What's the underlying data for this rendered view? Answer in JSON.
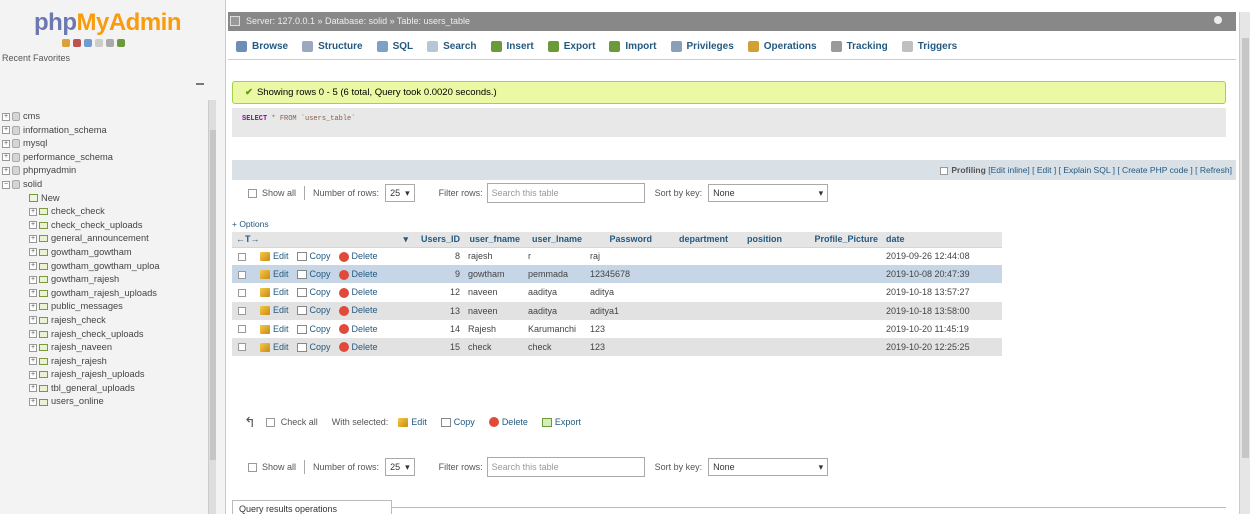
{
  "logo": {
    "part1": "php",
    "part2": "MyAdmin"
  },
  "recent_label": "Recent  Favorites",
  "tree": [
    {
      "label": "cms",
      "level": 0,
      "kind": "db"
    },
    {
      "label": "information_schema",
      "level": 0,
      "kind": "db"
    },
    {
      "label": "mysql",
      "level": 0,
      "kind": "db"
    },
    {
      "label": "performance_schema",
      "level": 0,
      "kind": "db"
    },
    {
      "label": "phpmyadmin",
      "level": 0,
      "kind": "db"
    },
    {
      "label": "solid",
      "level": 0,
      "kind": "db",
      "open": true
    },
    {
      "label": "New",
      "level": 1,
      "kind": "new"
    },
    {
      "label": "check_check",
      "level": 1,
      "kind": "table"
    },
    {
      "label": "check_check_uploads",
      "level": 1,
      "kind": "table"
    },
    {
      "label": "general_announcement",
      "level": 1,
      "kind": "table"
    },
    {
      "label": "gowtham_gowtham",
      "level": 1,
      "kind": "table"
    },
    {
      "label": "gowtham_gowtham_uploa",
      "level": 1,
      "kind": "table"
    },
    {
      "label": "gowtham_rajesh",
      "level": 1,
      "kind": "table"
    },
    {
      "label": "gowtham_rajesh_uploads",
      "level": 1,
      "kind": "table"
    },
    {
      "label": "public_messages",
      "level": 1,
      "kind": "table"
    },
    {
      "label": "rajesh_check",
      "level": 1,
      "kind": "table"
    },
    {
      "label": "rajesh_check_uploads",
      "level": 1,
      "kind": "table"
    },
    {
      "label": "rajesh_naveen",
      "level": 1,
      "kind": "table"
    },
    {
      "label": "rajesh_rajesh",
      "level": 1,
      "kind": "table"
    },
    {
      "label": "rajesh_rajesh_uploads",
      "level": 1,
      "kind": "table"
    },
    {
      "label": "tbl_general_uploads",
      "level": 1,
      "kind": "table"
    },
    {
      "label": "users_online",
      "level": 1,
      "kind": "table"
    }
  ],
  "breadcrumb": "Server: 127.0.0.1 » Database: solid » Table: users_table",
  "tabs": [
    {
      "label": "Browse",
      "icon": "browse-icon",
      "color": "#6d8fb5"
    },
    {
      "label": "Structure",
      "icon": "structure-icon",
      "color": "#9aa8c0"
    },
    {
      "label": "SQL",
      "icon": "sql-icon",
      "color": "#7ca2c6"
    },
    {
      "label": "Search",
      "icon": "search-icon",
      "color": "#b5c6d8"
    },
    {
      "label": "Insert",
      "icon": "insert-icon",
      "color": "#6a9a3a"
    },
    {
      "label": "Export",
      "icon": "export-icon",
      "color": "#6a9a3a"
    },
    {
      "label": "Import",
      "icon": "import-icon",
      "color": "#6a9a3a"
    },
    {
      "label": "Privileges",
      "icon": "privileges-icon",
      "color": "#8aa0b8"
    },
    {
      "label": "Operations",
      "icon": "operations-icon",
      "color": "#d1a135"
    },
    {
      "label": "Tracking",
      "icon": "tracking-icon",
      "color": "#9a9a9a"
    },
    {
      "label": "Triggers",
      "icon": "triggers-icon",
      "color": "#c0c0c0"
    }
  ],
  "success_message": "Showing rows 0 - 5 (6 total, Query took 0.0020 seconds.)",
  "sql": {
    "keyword": "SELECT",
    "rest": " * FROM `users_table`"
  },
  "profiling": {
    "label": "Profiling",
    "links": "[Edit inline] [ Edit ] [ Explain SQL ] [ Create PHP code ] [ Refresh]"
  },
  "nav": {
    "show_all": "Show all",
    "rows_label": "Number of rows:",
    "rows_value": "25",
    "filter_label": "Filter rows:",
    "filter_placeholder": "Search this table",
    "sort_label": "Sort by key:",
    "sort_value": "None"
  },
  "options_label": "+ Options",
  "columns": [
    "Users_ID",
    "user_fname",
    "user_lname",
    "Password",
    "department",
    "position",
    "Profile_Picture",
    "date"
  ],
  "row_actions": {
    "edit": "Edit",
    "copy": "Copy",
    "delete": "Delete"
  },
  "rows": [
    {
      "id": "8",
      "fname": "rajesh",
      "lname": "r",
      "password": "raj",
      "department": "",
      "position": "",
      "picture": "",
      "date": "2019-09-26 12:44:08"
    },
    {
      "id": "9",
      "fname": "gowtham",
      "lname": "pemmada",
      "password": "12345678",
      "department": "",
      "position": "",
      "picture": "",
      "date": "2019-10-08 20:47:39"
    },
    {
      "id": "12",
      "fname": "naveen",
      "lname": "aaditya",
      "password": "aditya",
      "department": "",
      "position": "",
      "picture": "",
      "date": "2019-10-18 13:57:27"
    },
    {
      "id": "13",
      "fname": "naveen",
      "lname": "aaditya",
      "password": "aditya1",
      "department": "",
      "position": "",
      "picture": "",
      "date": "2019-10-18 13:58:00"
    },
    {
      "id": "14",
      "fname": "Rajesh",
      "lname": "Karumanchi",
      "password": "123",
      "department": "",
      "position": "",
      "picture": "",
      "date": "2019-10-20 11:45:19"
    },
    {
      "id": "15",
      "fname": "check",
      "lname": "check",
      "password": "123",
      "department": "",
      "position": "",
      "picture": "",
      "date": "2019-10-20 12:25:25"
    }
  ],
  "bulk": {
    "check_all": "Check all",
    "with_selected": "With selected:",
    "edit": "Edit",
    "copy": "Copy",
    "delete": "Delete",
    "export": "Export"
  },
  "query_ops": "Query results operations"
}
